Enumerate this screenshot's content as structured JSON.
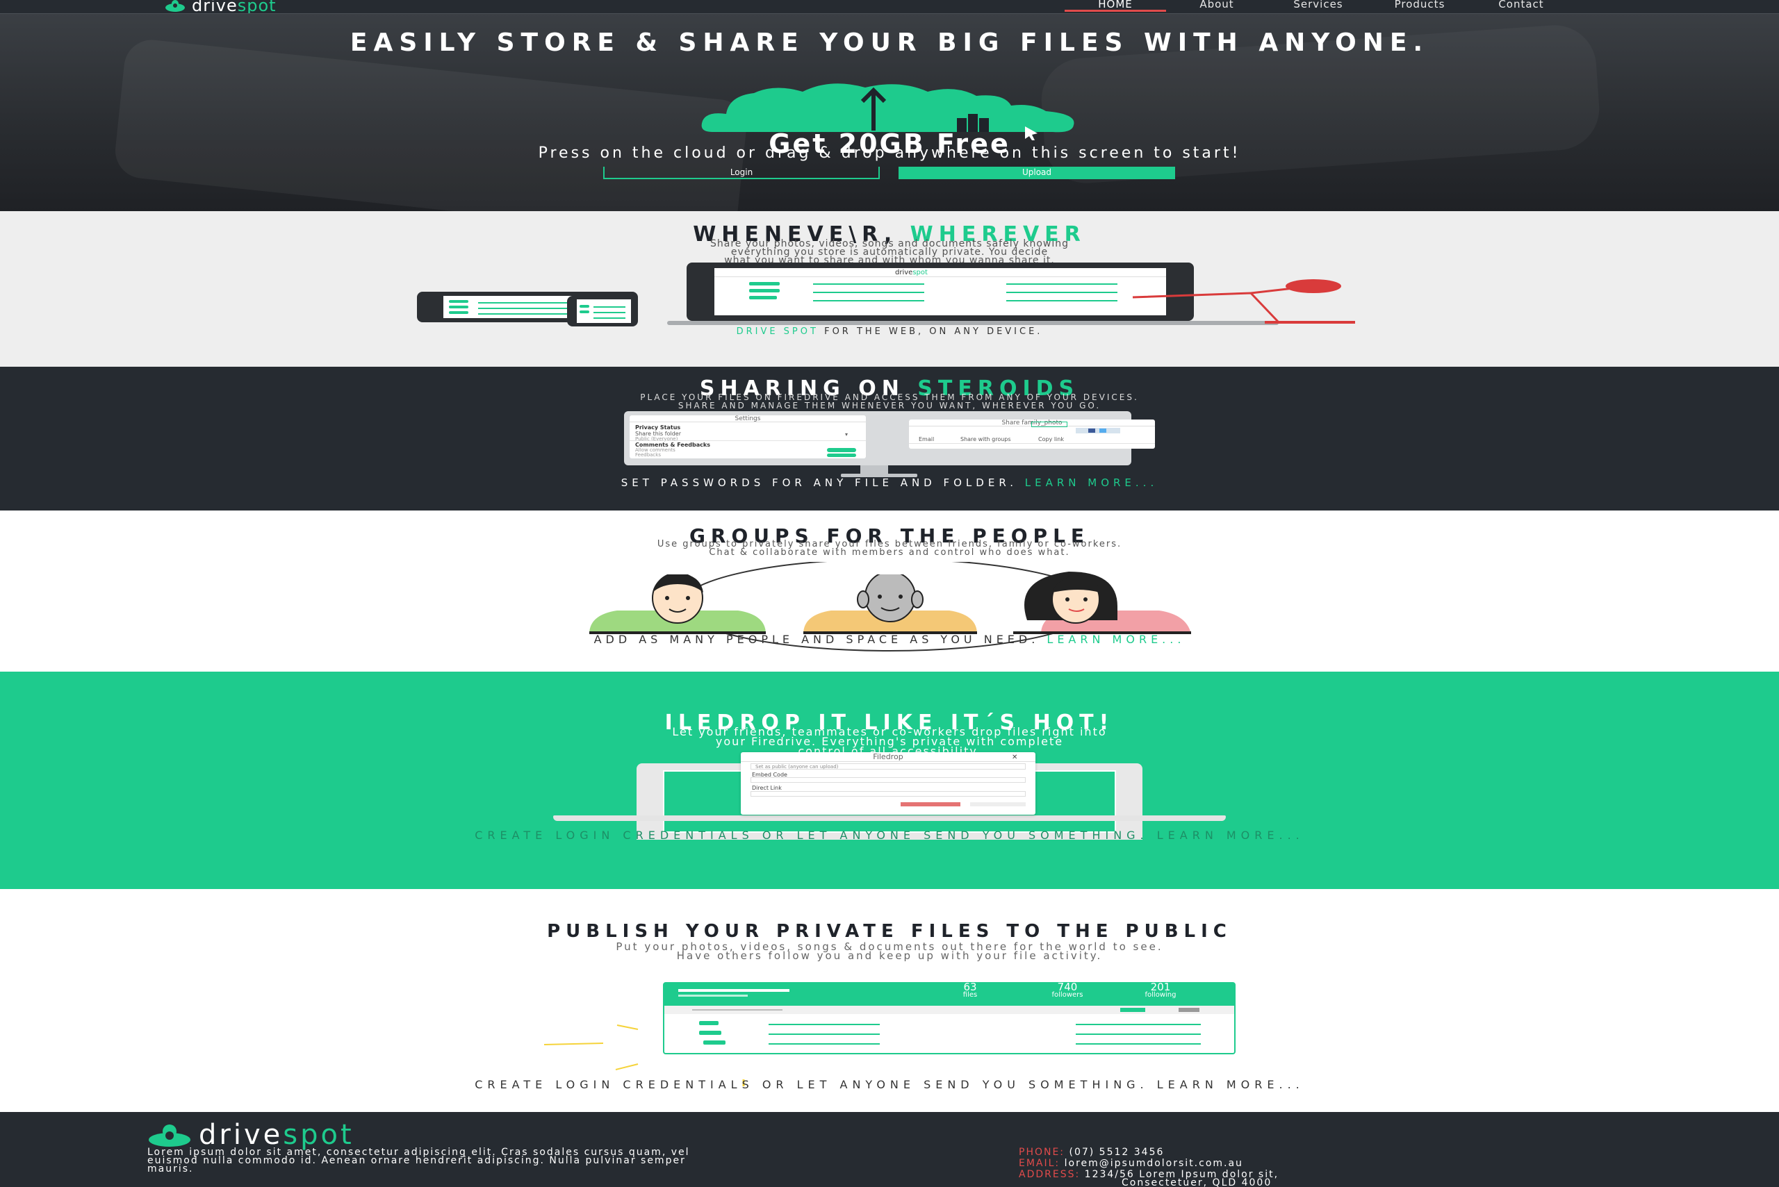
{
  "nav": {
    "brand_a": "drive",
    "brand_b": "spot",
    "items": [
      "HOME",
      "About",
      "Services",
      "Products",
      "Contact"
    ]
  },
  "hero": {
    "title": "EASILY STORE & SHARE YOUR BIG FILES WITH ANYONE.",
    "headline": "Get 20GB Free",
    "subtitle": "Press on the cloud or drag & drop anywhere on this screen to start!",
    "login_label": "Login",
    "upload_label": "Upload"
  },
  "whenever": {
    "title_a": "WHENEVE\\R,",
    "title_b": "WHEREVER",
    "text_1": "Share your photos, videos, songs and documents safely knowing",
    "text_2": "everything you store is automatically private. You decide",
    "text_3": "what you want to share and with whom you wanna share it.",
    "screen_brand_a": "drive",
    "screen_brand_b": "spot",
    "footer_a": "DRIVE SPOT",
    "footer_b": "FOR THE WEB, ON ANY DEVICE."
  },
  "steroids": {
    "title_a": "SHARING ON",
    "title_b": "STEROIDS",
    "text_1": "PLACE YOUR FILES ON FIREDRIVE AND ACCESS THEM FROM ANY OF YOUR DEVICES.",
    "text_2": "SHARE AND MANAGE THEM WHENEVER YOU WANT, WHEREVER YOU GO.",
    "settings_dialog": {
      "title": "Settings",
      "row1": "Privacy Status",
      "row2": "Share this folder",
      "row3": "Public (Everyone)",
      "row4": "Comments & Feedbacks",
      "row5": "Allow comments",
      "row6": "Feedbacks"
    },
    "share_dialog": {
      "title": "Share   family_photo",
      "col1": "Email",
      "col2": "Share with groups",
      "col3": "Copy link"
    },
    "footer_a": "SET PASSWORDS FOR ANY FILE AND FOLDER.",
    "footer_b": "LEARN MORE..."
  },
  "groups": {
    "title": "GROUPS FOR THE PEOPLE",
    "text_1": "Use groups to privately share your files between friends, family or co-workers.",
    "text_2": "Chat & collaborate with members and control who does what.",
    "footer_a": "ADD AS MANY PEOPLE AND SPACE AS YOU NEED.",
    "footer_b": "LEARN MORE..."
  },
  "filedrop": {
    "title": "ILEDROP IT LIKE IT´S HOT!",
    "text_1": "Let your friends, teammates or co-workers drop files right into",
    "text_2": "your Firedrive. Everything's private with complete",
    "text_3": "control of all accessibility.",
    "dialog": {
      "title": "Filedrop",
      "select": "Set as public (anyone can upload)",
      "embed": "Embed Code",
      "direct": "Direct Link"
    },
    "footer": "CREATE LOGIN CREDENTIALS OR LET ANYONE SEND YOU SOMETHING. LEARN MORE..."
  },
  "publish": {
    "title": "PUBLISH YOUR PRIVATE FILES TO THE PUBLIC",
    "text_1": "Put your photos, videos, songs & documents out there for the world to see.",
    "text_2": "Have others follow you and keep up with your file activity.",
    "stats": [
      {
        "num": "63",
        "label": "files"
      },
      {
        "num": "740",
        "label": "followers"
      },
      {
        "num": "201",
        "label": "following"
      }
    ],
    "footer": "CREATE LOGIN CREDENTIALS OR LET ANYONE SEND YOU SOMETHING. LEARN MORE..."
  },
  "footer": {
    "brand_a": "drive",
    "brand_b": "spot",
    "about_1": "Lorem ipsum dolor sit amet, consectetur adipiscing elit. Cras sodales cursus quam, vel",
    "about_2": "euismod nulla commodo id. Aenean ornare hendrerit adipiscing. Nulla pulvinar semper",
    "about_3": "mauris.",
    "phone_label": "PHONE:",
    "phone": "(07) 5512 3456",
    "email_label": "EMAIL:",
    "email": "lorem@ipsumdolorsit.com.au",
    "address_label": "ADDRESS:",
    "address_1": "1234/56 Lorem Ipsum dolor sit,",
    "address_2": "Consectetuer, QLD 4000"
  },
  "colors": {
    "accent": "#1ecb8d",
    "dark": "#262b31",
    "highlight": "#e14b4b"
  }
}
